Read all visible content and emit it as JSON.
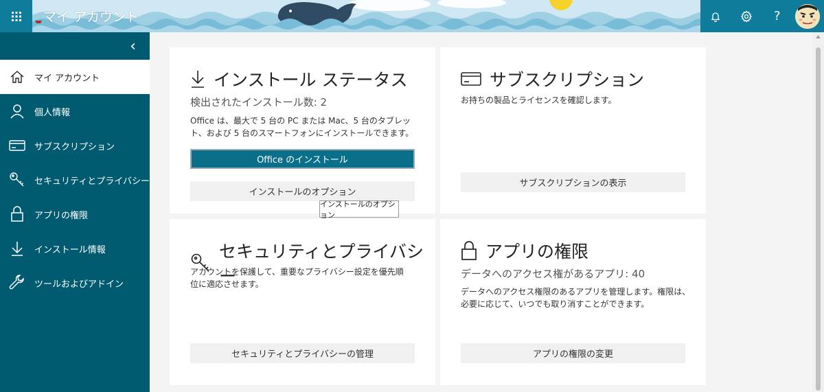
{
  "header": {
    "app_title": "マイ アカウント",
    "icons": [
      "waffle-icon",
      "bell-icon",
      "gear-icon",
      "help-icon",
      "avatar"
    ],
    "help_glyph": "?"
  },
  "sidebar": {
    "collapse_glyph": "‹",
    "items": [
      {
        "label": "マイ アカウント",
        "icon": "home-icon",
        "active": true
      },
      {
        "label": "個人情報",
        "icon": "person-icon",
        "active": false
      },
      {
        "label": "サブスクリプション",
        "icon": "card-icon",
        "active": false
      },
      {
        "label": "セキュリティとプライバシー",
        "icon": "key-icon",
        "active": false
      },
      {
        "label": "アプリの権限",
        "icon": "lock-icon",
        "active": false
      },
      {
        "label": "インストール情報",
        "icon": "download-icon",
        "active": false
      },
      {
        "label": "ツールおよびアドイン",
        "icon": "wrench-icon",
        "active": false
      }
    ]
  },
  "cards": {
    "install": {
      "title": "インストール ステータス",
      "count_text": "検出されたインストール数: 2",
      "description": "Office は、最大で 5 台の PC または Mac、5 台のタブレット、および 5 台のスマートフォンにインストールできます。",
      "primary_button": "Office のインストール",
      "secondary_button": "インストールのオプション",
      "tooltip": "インストールのオプション"
    },
    "subscription": {
      "title": "サブスクリプション",
      "description": "お持ちの製品とライセンスを確認します。",
      "button": "サブスクリプションの表示"
    },
    "security": {
      "title": "セキュリティとプライバシー",
      "description": "アカウントを保護して、重要なプライバシー設定を優先順位に適応させます。",
      "button": "セキュリティとプライバシーの管理"
    },
    "apps": {
      "title": "アプリの権限",
      "count_text": "データへのアクセス権があるアプリ: 40",
      "description": "データへのアクセス権限のあるアプリを管理します。権限は、必要に応じて、いつでも取り消すことができます。",
      "button": "アプリの権限の変更"
    }
  },
  "colors": {
    "brand": "#107c9c",
    "sidebar": "#005b70",
    "primary_button": "#0a7089"
  }
}
